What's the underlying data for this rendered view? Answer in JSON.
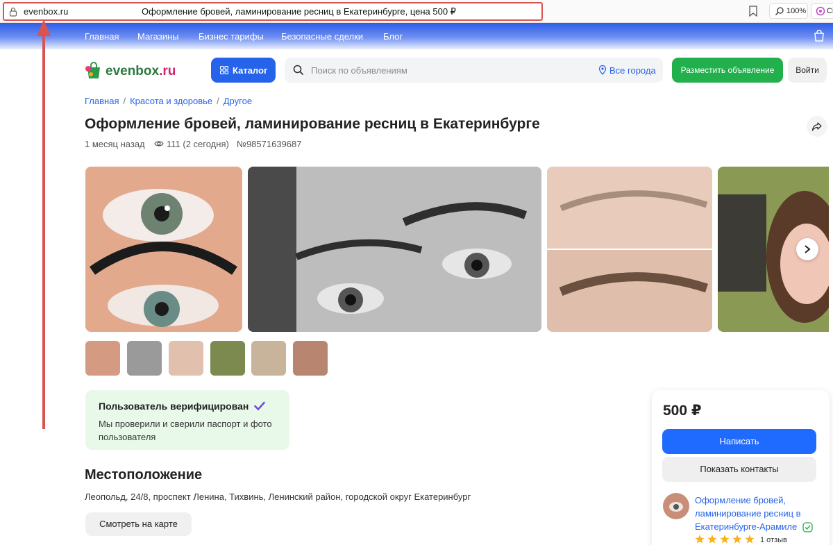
{
  "browser": {
    "url": "evenbox.ru",
    "tab_title": "Оформление бровей, ламинирование ресниц в Екатеринбурге, цена 500 ₽",
    "zoom": "100%",
    "extension_label": "Сі"
  },
  "nav": {
    "items": [
      {
        "label": "Главная"
      },
      {
        "label": "Магазины"
      },
      {
        "label": "Бизнес тарифы"
      },
      {
        "label": "Безопасные сделки"
      },
      {
        "label": "Блог"
      }
    ]
  },
  "header": {
    "logo_part1": "evenbox",
    "logo_part2": ".ru",
    "catalog_label": "Каталог",
    "search_placeholder": "Поиск по объявлениям",
    "city_label": "Все города",
    "post_ad_label": "Разместить объявление",
    "login_label": "Войти"
  },
  "breadcrumb": [
    {
      "label": "Главная"
    },
    {
      "label": "Красота и здоровье"
    },
    {
      "label": "Другое"
    }
  ],
  "listing": {
    "title": "Оформление бровей, ламинирование ресниц в Екатеринбурге",
    "posted": "1 месяц назад",
    "views": "111 (2 сегодня)",
    "number": "№98571639687",
    "photo_count": 6
  },
  "verified": {
    "title": "Пользователь верифицирован",
    "description": "Мы проверили и сверили паспорт и фото пользователя"
  },
  "location": {
    "heading": "Местоположение",
    "address": "Леопольд, 24/8, проспект Ленина, Тихвинь, Ленинский район, городской округ Екатеринбург",
    "map_button": "Смотреть на карте"
  },
  "sidebar": {
    "price": "500 ₽",
    "write_label": "Написать",
    "contacts_label": "Показать контакты",
    "seller_name": "Оформление бровей, ламинирование ресниц в Екатеринбурге-Арамиле",
    "rating": 5,
    "reviews": "1 отзыв"
  },
  "colors": {
    "brand_blue": "#2563eb",
    "green": "#22b04d",
    "annotation": "#d9534f"
  }
}
